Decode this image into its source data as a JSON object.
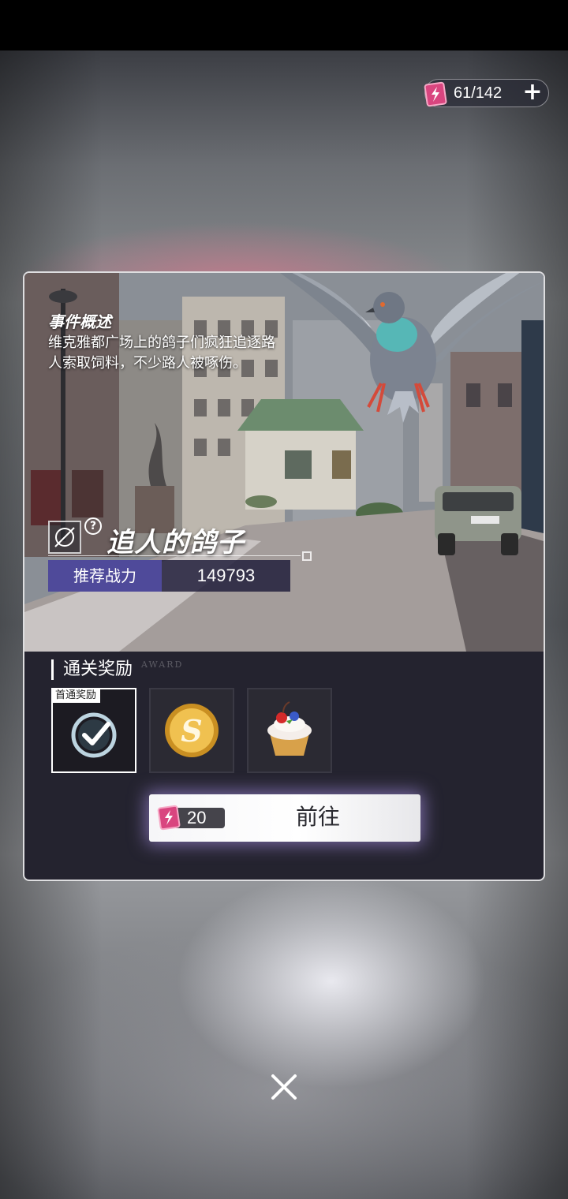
{
  "stamina": {
    "current_max": "61/142",
    "add_icon": "plus-icon"
  },
  "event": {
    "summary_title": "事件概述",
    "summary_text": "维克雅都广场上的鸽子们疯狂追逐路人索取饲料，不少路人被啄伤。",
    "stage_name": "追人的鸽子",
    "power_label": "推荐战力",
    "power_value": "149793"
  },
  "rewards": {
    "title": "通关奖励",
    "title_en": "AWARD",
    "first_clear_tag": "首通奖励",
    "items": [
      {
        "icon": "checkmark-badge-icon"
      },
      {
        "icon": "gold-coin-icon"
      },
      {
        "icon": "cake-icon"
      }
    ]
  },
  "go_button": {
    "cost": "20",
    "label": "前往"
  },
  "colors": {
    "accent": "#4f4a9a",
    "ticket": "#d9457f",
    "panel": "#24232f"
  }
}
